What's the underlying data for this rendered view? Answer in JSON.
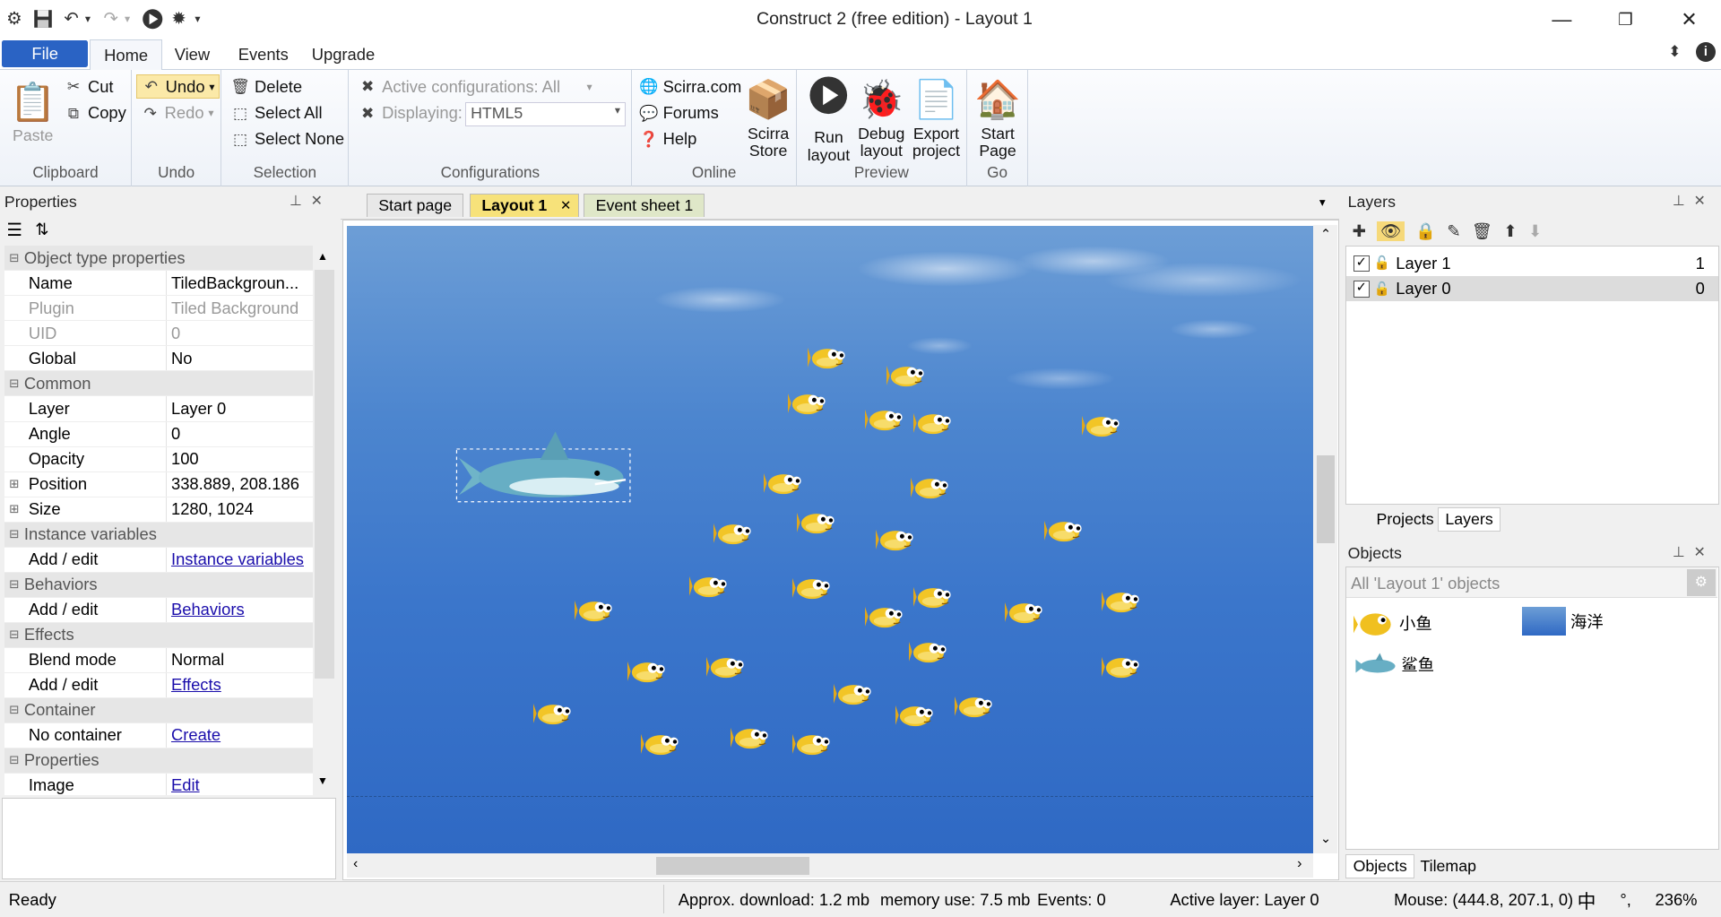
{
  "window": {
    "title": "Construct 2  (free edition) - Layout 1"
  },
  "ribbon_tabs": [
    "File",
    "Home",
    "View",
    "Events",
    "Upgrade"
  ],
  "clipboard": {
    "paste": "Paste",
    "cut": "Cut",
    "copy": "Copy",
    "label": "Clipboard"
  },
  "undo": {
    "undo": "Undo",
    "redo": "Redo",
    "label": "Undo"
  },
  "selection": {
    "delete": "Delete",
    "select_all": "Select All",
    "select_none": "Select None",
    "label": "Selection"
  },
  "configurations": {
    "active": "Active configurations: All",
    "displaying": "Displaying:",
    "displaying_value": "HTML5",
    "label": "Configurations"
  },
  "online": {
    "scirra": "Scirra.com",
    "forums": "Forums",
    "help": "Help",
    "store_line1": "Scirra",
    "store_line2": "Store",
    "label": "Online"
  },
  "preview": {
    "run_l1": "Run",
    "run_l2": "layout",
    "debug_l1": "Debug",
    "debug_l2": "layout",
    "export_l1": "Export",
    "export_l2": "project",
    "label": "Preview"
  },
  "go": {
    "start_l1": "Start",
    "start_l2": "Page",
    "label": "Go"
  },
  "properties": {
    "title": "Properties",
    "rows": [
      {
        "type": "cat",
        "label": "Object type properties"
      },
      {
        "k": "Name",
        "v": "TiledBackgroun..."
      },
      {
        "k": "Plugin",
        "v": "Tiled Background",
        "gray": true
      },
      {
        "k": "UID",
        "v": "0",
        "gray": true
      },
      {
        "k": "Global",
        "v": "No"
      },
      {
        "type": "cat",
        "label": "Common"
      },
      {
        "k": "Layer",
        "v": "Layer 0"
      },
      {
        "k": "Angle",
        "v": "0"
      },
      {
        "k": "Opacity",
        "v": "100"
      },
      {
        "k": "Position",
        "v": "338.889, 208.186",
        "exp": true
      },
      {
        "k": "Size",
        "v": "1280, 1024",
        "exp": true
      },
      {
        "type": "cat",
        "label": "Instance variables"
      },
      {
        "k": "Add / edit",
        "v": "Instance variables",
        "link": true
      },
      {
        "type": "cat",
        "label": "Behaviors"
      },
      {
        "k": "Add / edit",
        "v": "Behaviors",
        "link": true
      },
      {
        "type": "cat",
        "label": "Effects"
      },
      {
        "k": "Blend mode",
        "v": "Normal"
      },
      {
        "k": "Add / edit",
        "v": "Effects",
        "link": true
      },
      {
        "type": "cat",
        "label": "Container"
      },
      {
        "k": "No container",
        "v": "Create",
        "link": true
      },
      {
        "type": "cat",
        "label": "Properties"
      },
      {
        "k": "Image",
        "v": "Edit",
        "link": true
      }
    ]
  },
  "doc_tabs": [
    "Start page",
    "Layout 1",
    "Event sheet 1"
  ],
  "layers": {
    "title": "Layers",
    "items": [
      {
        "name": "Layer 1",
        "num": "1"
      },
      {
        "name": "Layer 0",
        "num": "0"
      }
    ],
    "tabs": [
      "Projects",
      "Layers"
    ]
  },
  "objects": {
    "title": "Objects",
    "filter": "All 'Layout 1' objects",
    "items": [
      "小鱼",
      "海洋",
      "鲨鱼"
    ],
    "tabs": [
      "Objects",
      "Tilemap"
    ]
  },
  "status": {
    "ready": "Ready",
    "download": "Approx. download: 1.2 mb",
    "memory": "memory use: 7.5 mb",
    "events": "Events: 0",
    "active_layer": "Active layer: Layer 0",
    "mouse": "Mouse: (444.8, 207.1, 0)",
    "zoom": "236%",
    "ime1": "中",
    "ime2": "°,"
  },
  "colors": {
    "file_tab": "#2a63c4",
    "water": "#3b76cb",
    "active_doc_tab": "#f7e27a"
  }
}
